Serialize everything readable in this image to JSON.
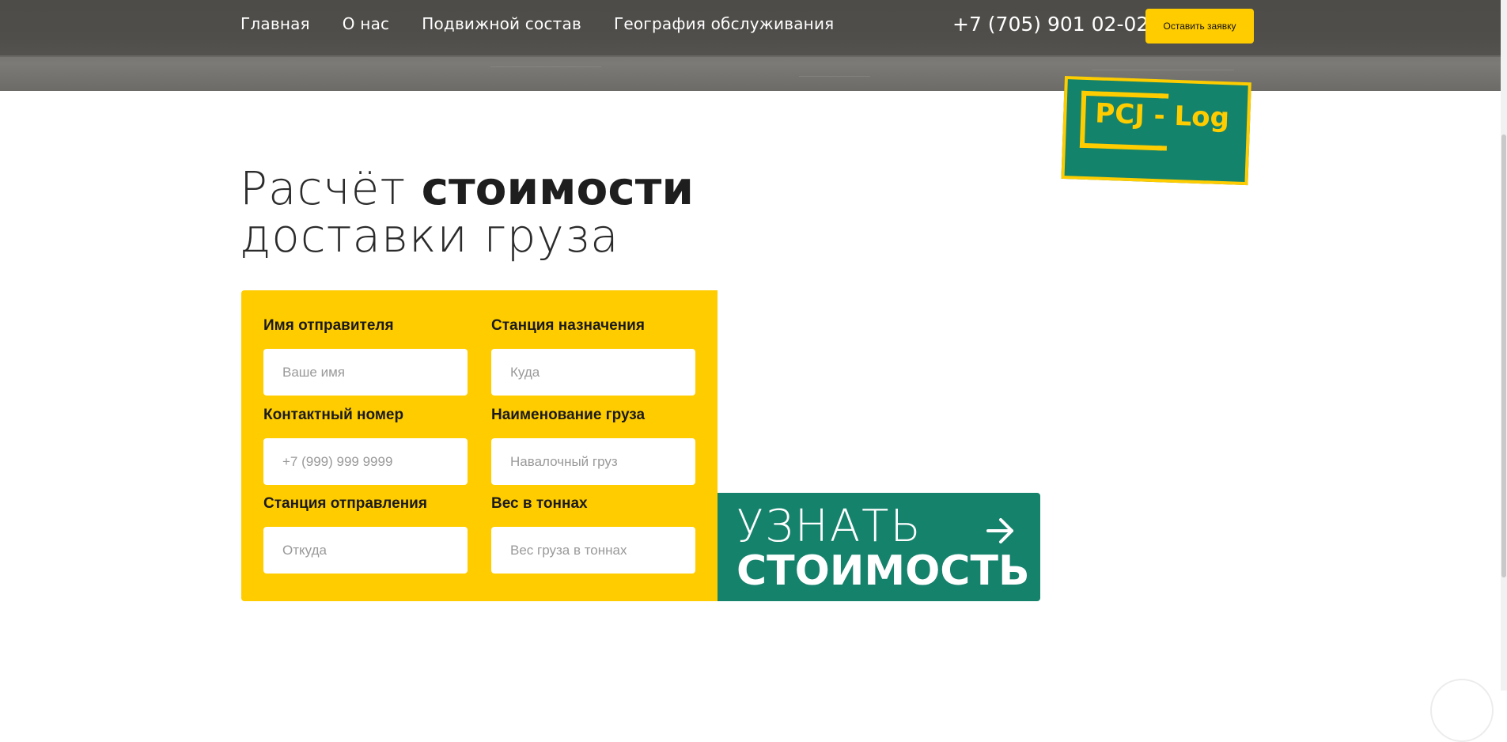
{
  "nav": {
    "items": [
      "Главная",
      "О нас",
      "Подвижной состав",
      "География обслуживания"
    ],
    "phone": "+7 (705) 901 02-02",
    "cta_label": "Оставить заявку"
  },
  "logo": {
    "text": "PCJ - Log"
  },
  "title": {
    "line1_light": "Расчёт ",
    "line1_bold": "стоимости",
    "line2": "доставки груза"
  },
  "form": {
    "sender_name": {
      "label": "Имя отправителя",
      "placeholder": "Ваше имя",
      "value": ""
    },
    "destination": {
      "label": "Станция назначения",
      "placeholder": "Куда",
      "value": ""
    },
    "contact": {
      "label": "Контактный номер",
      "placeholder": "+7 (999) 999 9999",
      "value": ""
    },
    "cargo_name": {
      "label": "Наименование груза",
      "placeholder": "Навалочный груз",
      "value": ""
    },
    "departure": {
      "label": "Станция отправления",
      "placeholder": "Откуда",
      "value": ""
    },
    "weight": {
      "label": "Вес в тоннах",
      "placeholder": "Вес груза в тоннах",
      "value": ""
    }
  },
  "submit": {
    "line1": "УЗНАТЬ",
    "line2": "СТОИМОСТЬ"
  },
  "colors": {
    "accent_yellow": "#ffcc00",
    "accent_green": "#15826c",
    "header_gray": "#6a6864"
  },
  "icons": {
    "submit": "arrow-right-icon"
  }
}
